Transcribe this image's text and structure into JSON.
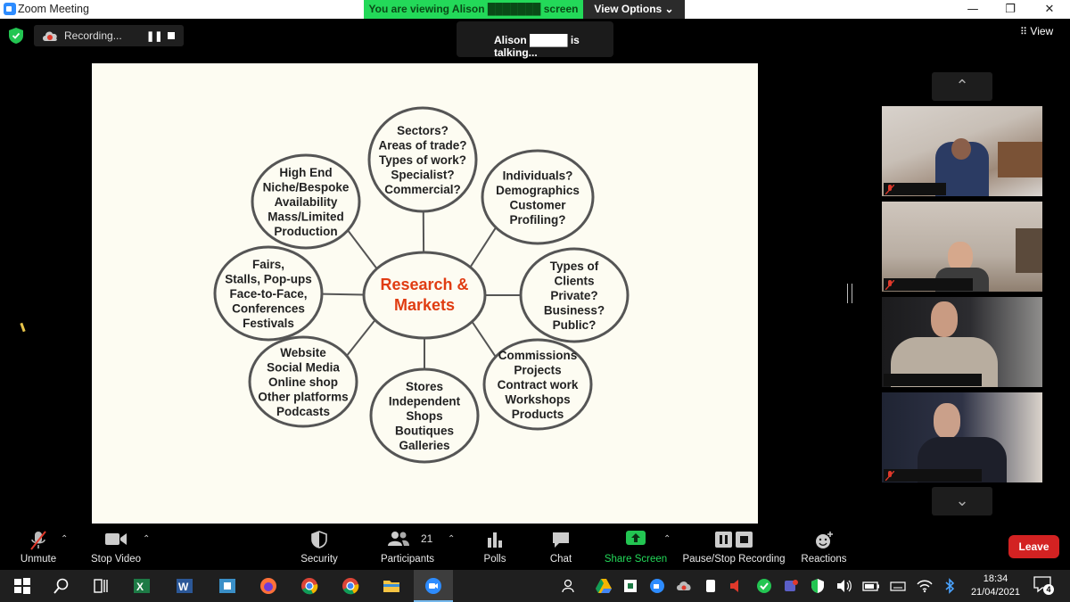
{
  "window": {
    "title": "Zoom Meeting",
    "minimize": "—",
    "restore": "❐",
    "close": "✕"
  },
  "banner": {
    "viewing_text": "You are viewing Alison ███████ screen",
    "view_options": "View Options ⌄"
  },
  "recording": {
    "label": "Recording...",
    "pause": "❚❚"
  },
  "talking": "Alison █████ is talking...",
  "view_button": "View",
  "slide": {
    "center": [
      "Research &",
      "Markets"
    ],
    "nodes": [
      {
        "lines": [
          "Sectors?",
          "Areas of trade?",
          "Types of work?",
          "Specialist?",
          "Commercial?"
        ]
      },
      {
        "lines": [
          "Individuals?",
          "Demographics",
          "Customer",
          "Profiling?"
        ]
      },
      {
        "lines": [
          "Types of",
          "Clients",
          "Private?",
          "Business?",
          "Public?"
        ]
      },
      {
        "lines": [
          "Commissions",
          "Projects",
          "Contract work",
          "Workshops",
          "Products"
        ]
      },
      {
        "lines": [
          "Stores",
          "Independent",
          "Shops",
          "Boutiques",
          "Galleries"
        ]
      },
      {
        "lines": [
          "Website",
          "Social Media",
          "Online shop",
          "Other platforms",
          "Podcasts"
        ]
      },
      {
        "lines": [
          "Fairs,",
          "Stalls, Pop-ups",
          "Face-to-Face,",
          "Conferences",
          "Festivals"
        ]
      },
      {
        "lines": [
          "High End",
          "Niche/Bespoke",
          "Availability",
          "Mass/Limited",
          "Production"
        ]
      }
    ],
    "colors": {
      "center_text": "#e03c12",
      "stroke": "#555555",
      "text": "#222222"
    }
  },
  "toolbar": {
    "unmute": "Unmute",
    "stop_video": "Stop Video",
    "security": "Security",
    "participants": "Participants",
    "participants_count": "21",
    "polls": "Polls",
    "chat": "Chat",
    "share_screen": "Share Screen",
    "pause_stop_recording": "Pause/Stop Recording",
    "reactions": "Reactions",
    "leave": "Leave"
  },
  "taskbar": {
    "time": "18:34",
    "date": "21/04/2021",
    "notifications": "4"
  }
}
